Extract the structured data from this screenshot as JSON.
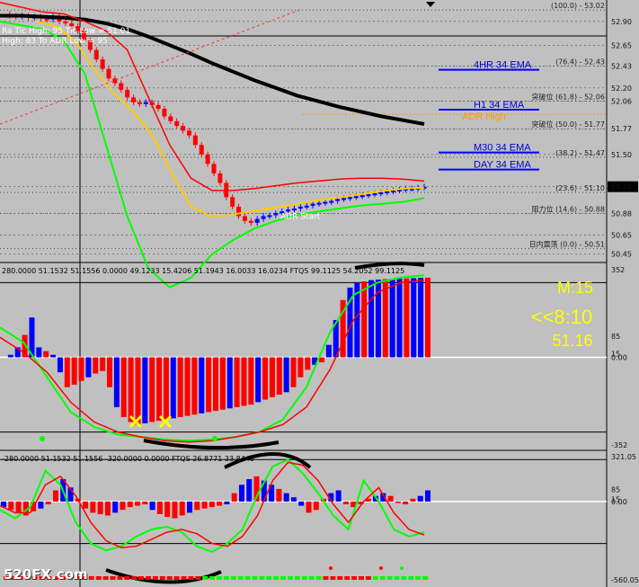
{
  "chart_data": [
    {
      "type": "candlestick",
      "panel": "price",
      "y_axis_labels": [
        "52.90",
        "52.65",
        "52.43",
        "52.20",
        "52.06",
        "51.77",
        "51.50",
        "51.16",
        "50.88",
        "50.65",
        "50.45"
      ],
      "current_price_label": "51.16",
      "ylim": [
        50.4,
        53.05
      ],
      "info_lines": [
        "Ra Tic High: 95 Tic Low = 51.01",
        "High: 83  To ADR Low = 95"
      ],
      "fibo_levels": [
        {
          "label": "(100.0) - 53.02",
          "value": 53.02
        },
        {
          "label": "(76.4) - 52.43",
          "value": 52.43
        },
        {
          "label": "突破位 (61.8) - 52.06",
          "value": 52.06
        },
        {
          "label": "突破位 (50.0) - 51.77",
          "value": 51.77
        },
        {
          "label": "(38.2) - 51.47",
          "value": 51.47
        },
        {
          "label": "(23.6) - 51.10",
          "value": 51.1
        },
        {
          "label": "阻力位 (14.6) - 50.88",
          "value": 50.88
        },
        {
          "label": "日内震荡 (0.0) - 50.51",
          "value": 50.51
        }
      ],
      "ema_labels": [
        {
          "text": "4HR 34 EMA",
          "value": 52.4
        },
        {
          "text": "H1 34 EMA",
          "value": 51.98
        },
        {
          "text": "ADR High",
          "value": 51.96
        },
        {
          "text": "M30 34 EMA",
          "value": 51.53
        },
        {
          "text": "DAY 34 EMA",
          "value": 51.35
        }
      ],
      "annotation": "ADR Start",
      "close_series": [
        52.98,
        52.96,
        52.95,
        52.96,
        52.94,
        52.95,
        52.93,
        52.92,
        52.95,
        52.9,
        52.88,
        52.85,
        52.8,
        52.7,
        52.6,
        52.5,
        52.4,
        52.3,
        52.25,
        52.18,
        52.1,
        52.05,
        52.03,
        52.05,
        52.02,
        51.98,
        51.9,
        51.85,
        51.8,
        51.75,
        51.7,
        51.6,
        51.5,
        51.4,
        51.3,
        51.2,
        51.05,
        50.95,
        50.85,
        50.8,
        50.78,
        50.82,
        50.85,
        50.86,
        50.88,
        50.9,
        50.92,
        50.93,
        50.95,
        50.96,
        50.98,
        50.99,
        51.0,
        51.01,
        51.03,
        51.04,
        51.05,
        51.06,
        51.07,
        51.08,
        51.09,
        51.1,
        51.11,
        51.12,
        51.13,
        51.14,
        51.14,
        51.15,
        51.16
      ]
    },
    {
      "type": "bar",
      "panel": "oscillator-1",
      "header": "280.0000 51.1532 51.1556 0.0000 49.1233 15.4206 51.1943 16.0033 16.0234  FTQS 99.1125 54.2052 99.1125",
      "y_axis_labels": [
        "352",
        "85",
        "0.00",
        "15",
        "-352"
      ],
      "ylim": [
        -352,
        352
      ],
      "values": [
        0,
        10,
        40,
        90,
        160,
        40,
        25,
        10,
        -60,
        -120,
        -110,
        -95,
        -80,
        -65,
        -55,
        -120,
        -200,
        -240,
        -260,
        -270,
        -265,
        -260,
        -255,
        -250,
        -245,
        -240,
        -235,
        -230,
        -225,
        -220,
        -215,
        -210,
        -205,
        -200,
        -195,
        -190,
        -180,
        -170,
        -160,
        -150,
        -140,
        -120,
        -80,
        -50,
        -30,
        -20,
        50,
        150,
        230,
        280,
        300,
        305,
        310,
        312,
        314,
        315,
        316,
        317,
        318,
        319,
        320
      ],
      "side_labels": [
        "M:15",
        "<<8:10",
        "51.16"
      ]
    },
    {
      "type": "bar",
      "panel": "oscillator-2",
      "header": "-280.0000 51.1532 51.1556 -320.0000 0.0000  FTQS 26.8771 33.8448",
      "y_axis_labels": [
        "321.05",
        "85",
        "0.00",
        "15",
        "-560.05"
      ],
      "ylim": [
        -560.05,
        321.05
      ],
      "values": [
        -40,
        -60,
        -80,
        -100,
        -70,
        -50,
        -20,
        80,
        160,
        100,
        20,
        -50,
        -80,
        -90,
        -100,
        -80,
        -60,
        -40,
        -30,
        -20,
        -60,
        -90,
        -110,
        -120,
        -100,
        -80,
        -60,
        -50,
        -40,
        -30,
        -20,
        60,
        120,
        160,
        180,
        150,
        120,
        90,
        60,
        30,
        -30,
        -80,
        -60,
        20,
        60,
        80,
        -20,
        -40,
        -20,
        20,
        40,
        60,
        40,
        -10,
        -20,
        20,
        40,
        80
      ]
    }
  ],
  "logo_text": "520FX.com",
  "colors": {
    "background": "#c0c0c0",
    "bull": "#0000ff",
    "bear": "#ff0000",
    "ma_black": "#000000",
    "ma_yellow": "#ffcc00",
    "band": "#ff0000",
    "green": "#00ff00",
    "label_yellow": "#ffff00"
  }
}
